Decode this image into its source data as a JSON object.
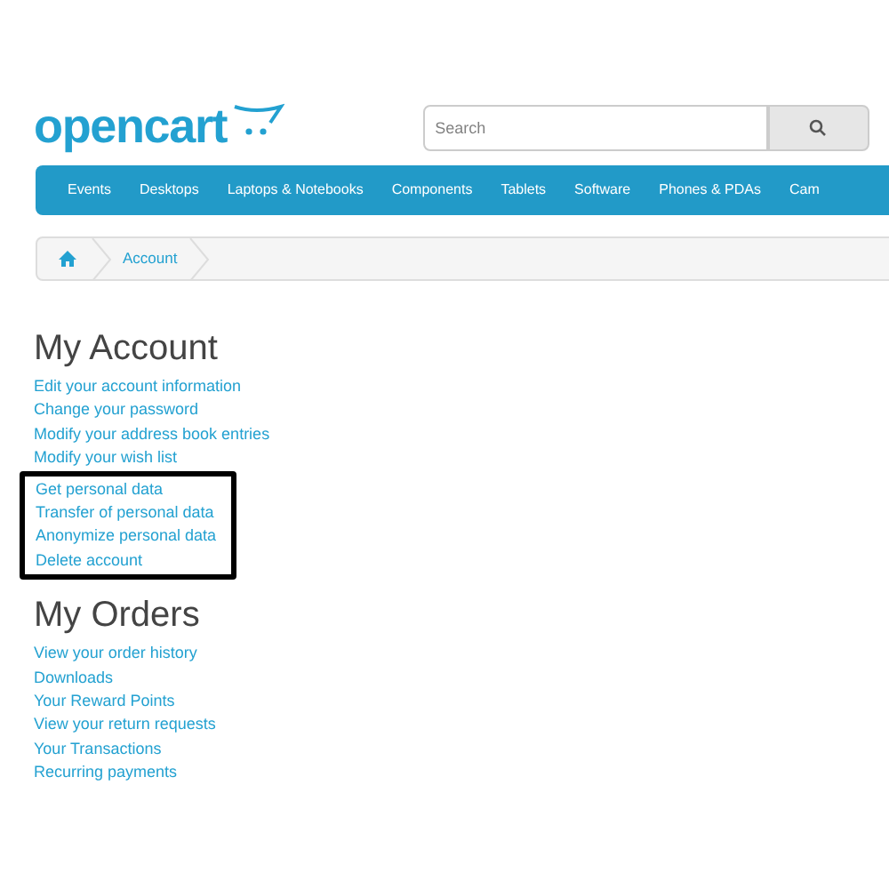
{
  "logo": {
    "text": "opencart"
  },
  "search": {
    "placeholder": "Search"
  },
  "nav": [
    "Events",
    "Desktops",
    "Laptops & Notebooks",
    "Components",
    "Tablets",
    "Software",
    "Phones & PDAs",
    "Cam"
  ],
  "breadcrumb": [
    "Account"
  ],
  "sections": [
    {
      "title": "My Account",
      "links": [
        "Edit your account information",
        "Change your password",
        "Modify your address book entries",
        "Modify your wish list"
      ],
      "highlighted_links": [
        "Get personal data",
        "Transfer of personal data",
        "Anonymize personal data",
        "Delete account"
      ]
    },
    {
      "title": "My Orders",
      "links": [
        "View your order history",
        "Downloads",
        "Your Reward Points",
        "View your return requests",
        "Your Transactions",
        "Recurring payments"
      ]
    }
  ]
}
